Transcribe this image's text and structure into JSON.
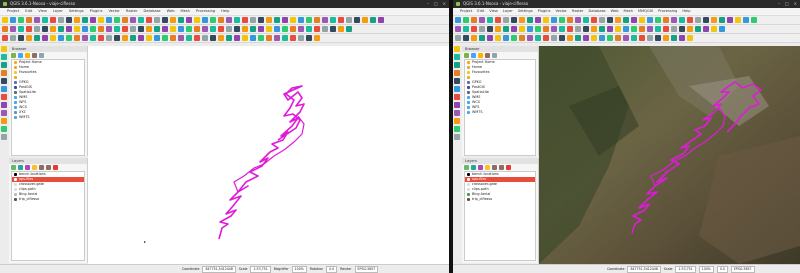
{
  "left_window": {
    "title": "QGIS 3.6.1-Noosa - viaje-ciflesso",
    "window_controls": [
      "–",
      "□",
      "×"
    ],
    "menu": [
      "Project",
      "Edit",
      "View",
      "Layer",
      "Settings",
      "Plugins",
      "Vector",
      "Raster",
      "Database",
      "Web",
      "Mesh",
      "Processing",
      "Help"
    ],
    "browser": {
      "header": "Browser",
      "items": [
        "Project Home",
        "Home",
        "Favourites",
        "",
        "GPKG",
        "PostGIS",
        "SpatiaLite",
        "WMS",
        "WFS",
        "WCS",
        "XYZ",
        "WMTS"
      ]
    },
    "layers": {
      "header": "Layers",
      "items": [
        "bench locations",
        "ops-files",
        "crossover-gate",
        "clips-path",
        "Bing Aerial",
        "trip_ciflesso"
      ]
    },
    "status": {
      "coordinate_label": "Coordinate",
      "coordinate_value": "847751,5412448",
      "scale_label": "Scale",
      "scale_value": "1:33,751",
      "magnifier_label": "Magnifier",
      "magnifier_value": "100%",
      "rotation_label": "Rotation",
      "rotation_value": "0.0",
      "render_label": "Render",
      "crs_value": "EPSG:3857"
    }
  },
  "right_window": {
    "title": "QGIS 3.6.1-Noosa - viaje-ciflesso",
    "window_controls": [
      "–",
      "□",
      "×"
    ],
    "menu": [
      "Project",
      "Edit",
      "View",
      "Layer",
      "Settings",
      "Plugins",
      "Vector",
      "Raster",
      "Database",
      "Web",
      "Mesh",
      "MMQGIS",
      "Processing",
      "Help"
    ],
    "browser": {
      "header": "Browser",
      "items": [
        "Project Home",
        "Home",
        "Favourites",
        "",
        "GPKG",
        "PostGIS",
        "SpatiaLite",
        "WMS",
        "WCS",
        "WFS",
        "WMTS"
      ]
    },
    "layers": {
      "header": "Layers",
      "items": [
        "bench locations",
        "ops-files",
        "crossover-gate",
        "clips-path",
        "Bing Aerial",
        "trip_ciflesso"
      ]
    },
    "status": {
      "coordinate_label": "Coordinate",
      "coordinate_value": "847751,5412448",
      "scale_label": "Scale",
      "scale_value": "1:33,751",
      "magnifier_value": "100%",
      "rotation_value": "0.0",
      "crs_value": "EPSG:3857"
    }
  },
  "colors": {
    "track": "#e01bd8",
    "selected_layer": "#e74c3c",
    "map_blank": "#ffffff",
    "terrain": "#5d5a3c"
  }
}
